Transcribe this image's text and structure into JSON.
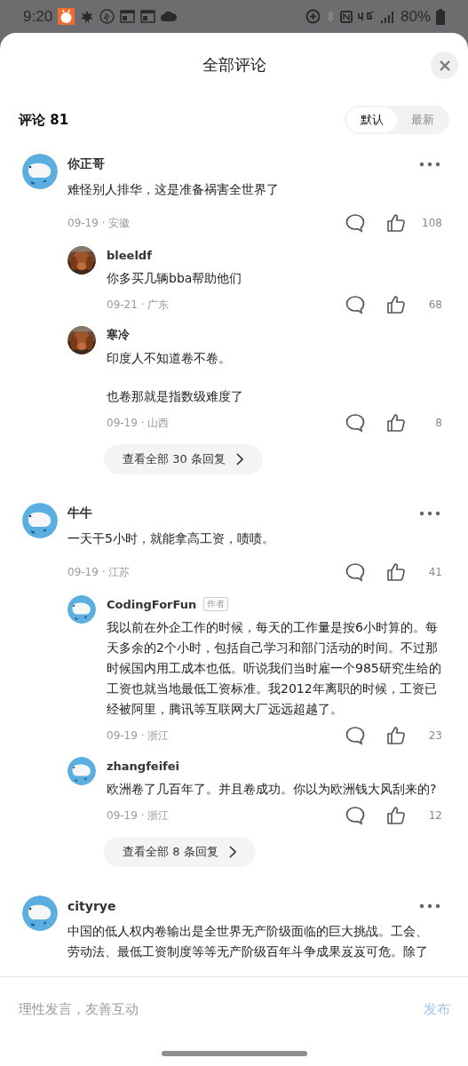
{
  "status_bar": {
    "time": "9:20",
    "battery": "80%"
  },
  "sheet": {
    "title": "全部评论"
  },
  "comment_count": "评论 81",
  "sort_tabs": [
    {
      "label": "默认",
      "selected": true
    },
    {
      "label": "最新",
      "selected": false
    }
  ],
  "comments": [
    {
      "author": "你正哥",
      "kind": "default",
      "text": "难怪别人排华，这是准备祸害全世界了",
      "meta": "09-19 · 安徽",
      "likes": "108",
      "replies": [
        {
          "author": "bleeldf",
          "kind": "picture",
          "text": "你多买几辆bba帮助他们",
          "meta": "09-21 · 广东",
          "likes": "68"
        },
        {
          "author": "寒冷",
          "kind": "picture",
          "paragraphs": [
            "印度人不知道卷不卷。",
            "也卷那就是指数级难度了"
          ],
          "meta": "09-19 · 山西",
          "likes": "8"
        }
      ],
      "more_replies": "查看全部 30 条回复"
    },
    {
      "author": "牛牛",
      "kind": "default",
      "text": "一天干5小时，就能拿高工资，啧啧。",
      "meta": "09-19 · 江苏",
      "likes": "41",
      "replies": [
        {
          "author": "CodingForFun",
          "badge": "作者",
          "kind": "default",
          "text": "我以前在外企工作的时候，每天的工作量是按6小时算的。每天多余的2个小时，包括自己学习和部门活动的时间。不过那时候国内用工成本也低。听说我们当时雇一个985研究生给的工资也就当地最低工资标准。我2012年离职的时候，工资已经被阿里，腾讯等互联网大厂远远超越了。",
          "meta": "09-19 · 浙江",
          "likes": "23"
        },
        {
          "author": "zhangfeifei",
          "kind": "default",
          "text": "欧洲卷了几百年了。并且卷成功。你以为欧洲钱大风刮来的?",
          "meta": "09-19 · 浙江",
          "likes": "12"
        }
      ],
      "more_replies": "查看全部 8 条回复"
    },
    {
      "author": "cityrye",
      "kind": "default",
      "text": "中国的低人权内卷输出是全世界无产阶级面临的巨大挑战。工会、劳动法、最低工资制度等等无产阶级百年斗争成果岌岌可危。除了"
    }
  ],
  "composer": {
    "placeholder": "理性发言，友善互动",
    "submit": "发布"
  }
}
